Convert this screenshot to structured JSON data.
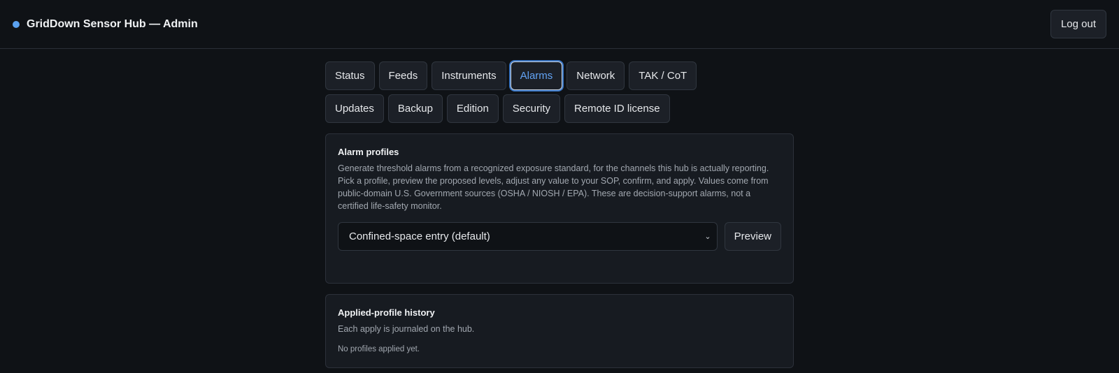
{
  "header": {
    "title": "GridDown Sensor Hub — Admin",
    "status_dot_color": "#5aa1f0",
    "logout_label": "Log out"
  },
  "tabs": [
    {
      "label": "Status",
      "active": false
    },
    {
      "label": "Feeds",
      "active": false
    },
    {
      "label": "Instruments",
      "active": false
    },
    {
      "label": "Alarms",
      "active": true
    },
    {
      "label": "Network",
      "active": false
    },
    {
      "label": "TAK / CoT",
      "active": false
    },
    {
      "label": "Updates",
      "active": false
    },
    {
      "label": "Backup",
      "active": false
    },
    {
      "label": "Edition",
      "active": false
    },
    {
      "label": "Security",
      "active": false
    },
    {
      "label": "Remote ID license",
      "active": false
    }
  ],
  "alarm_profiles": {
    "title": "Alarm profiles",
    "description": "Generate threshold alarms from a recognized exposure standard, for the channels this hub is actually reporting. Pick a profile, preview the proposed levels, adjust any value to your SOP, confirm, and apply. Values come from public-domain U.S. Government sources (OSHA / NIOSH / EPA). These are decision-support alarms, not a certified life-safety monitor.",
    "profile_select": {
      "selected": "Confined-space entry (default)"
    },
    "preview_label": "Preview"
  },
  "history": {
    "title": "Applied-profile history",
    "description": "Each apply is journaled on the hub.",
    "empty_text": "No profiles applied yet."
  },
  "colors": {
    "accent": "#62a3f5",
    "background": "#0f1216",
    "card": "#171b21"
  }
}
